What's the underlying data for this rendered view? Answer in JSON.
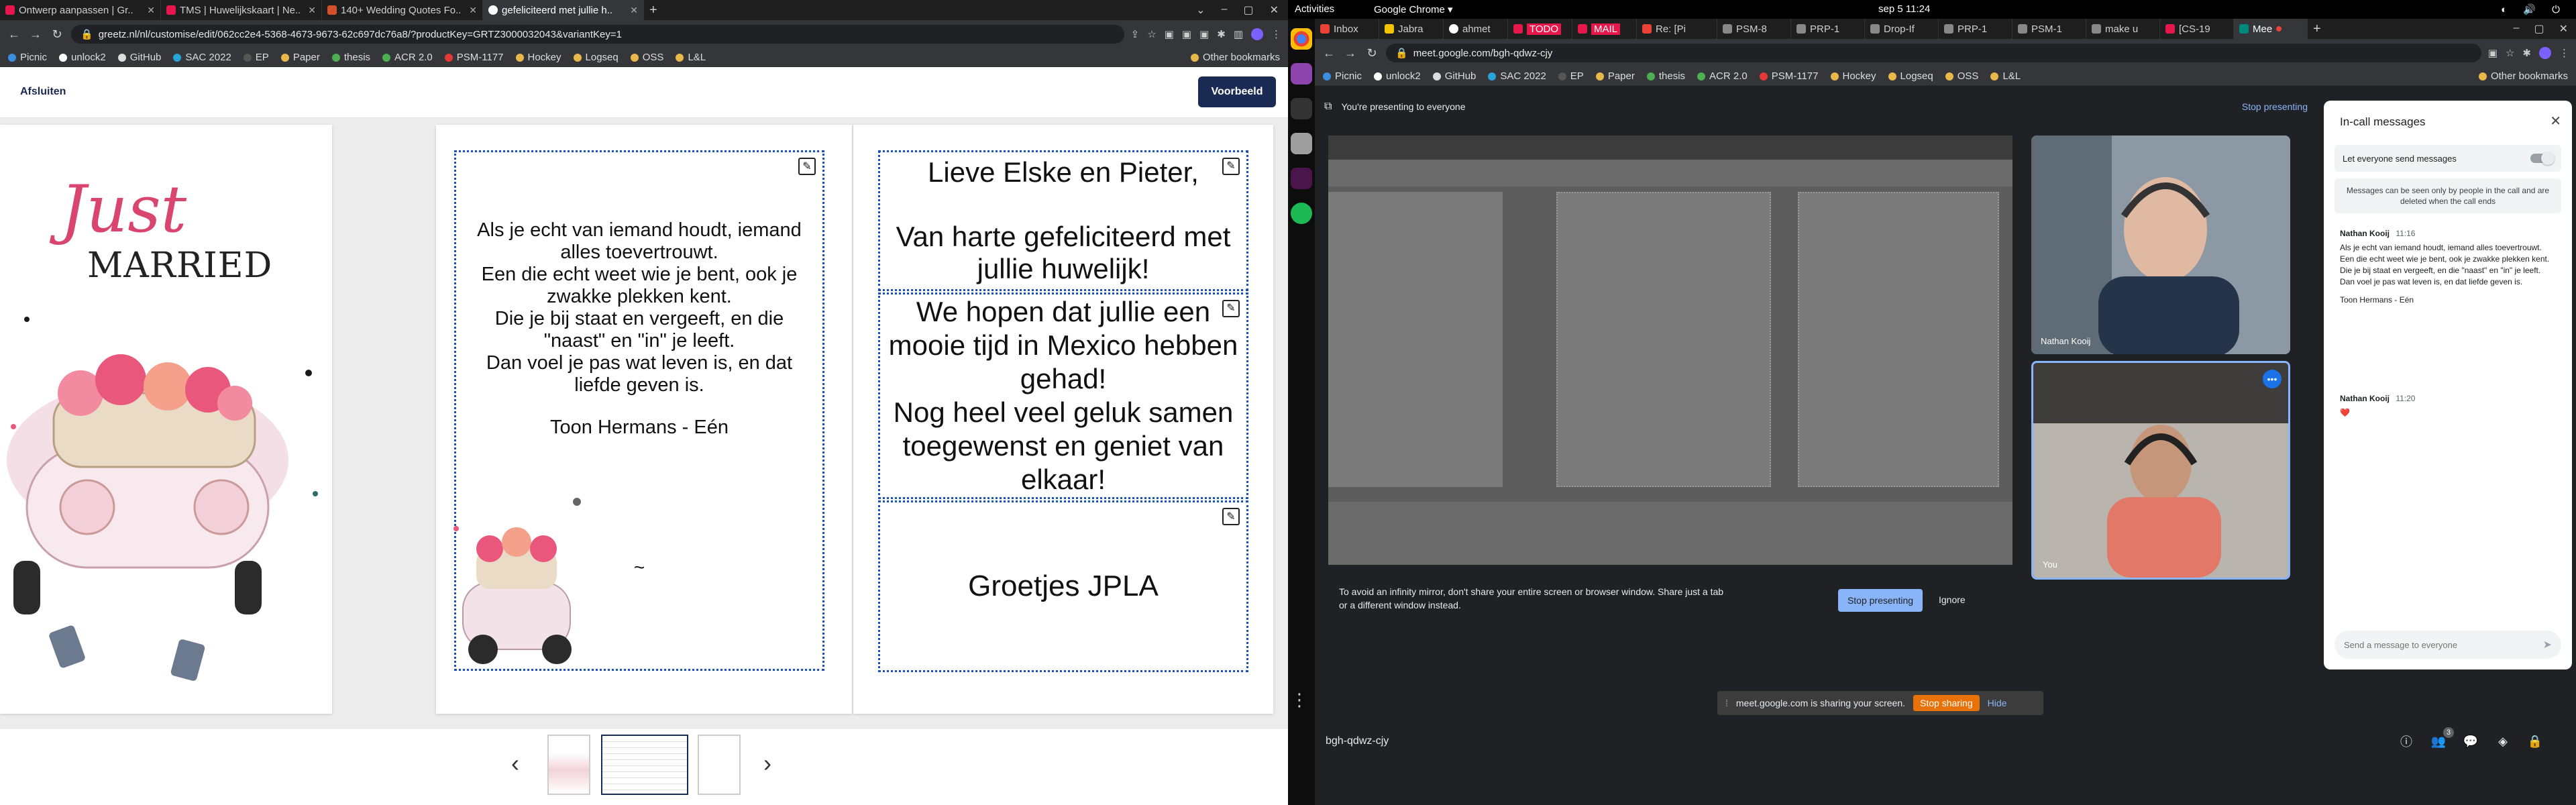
{
  "left_browser": {
    "tabs": [
      {
        "title": "Ontwerp aanpassen | Gr..",
        "color": "#e8174b"
      },
      {
        "title": "TMS | Huwelijkskaart | Ne..",
        "color": "#e8174b"
      },
      {
        "title": "140+ Wedding Quotes Fo..",
        "color": "#d4502a"
      },
      {
        "title": "gefeliciteerd met jullie h..",
        "color": "#8a8a8a",
        "active": true
      }
    ],
    "url": "greetz.nl/nl/customise/edit/062cc2e4-5368-4673-9673-62c697dc76a8/?productKey=GRTZ3000032043&variantKey=1",
    "bookmarks": [
      "Picnic",
      "unlock2",
      "GitHub",
      "SAC 2022",
      "EP",
      "Paper",
      "thesis",
      "ACR 2.0",
      "PSM-1177",
      "Hockey",
      "Logseq",
      "OSS",
      "L&L"
    ],
    "other_bookmarks": "Other bookmarks"
  },
  "editor": {
    "close_label": "Afsluiten",
    "preview_label": "Voorbeeld",
    "front": {
      "title_script": "Just",
      "title_caps": "MARRIED"
    },
    "inside_left": {
      "poem": "Als je echt van iemand houdt, iemand alles toevertrouwt.\nEen die echt weet wie je bent, ook je zwakke plekken kent.\nDie je bij staat en vergeeft, en die \"naast\" en \"in\" je leeft.\nDan voel je pas wat leven is, en dat liefde geven is.",
      "author": "Toon Hermans - Eén",
      "tilde": "~"
    },
    "inside_right": {
      "box1": "Lieve Elske en Pieter,\n\nVan harte gefeliciteerd met jullie huwelijk!",
      "box2": "We hopen dat jullie een mooie tijd in Mexico hebben gehad!\nNog heel veel geluk samen toegewenst en geniet van elkaar!",
      "box3": "Groetjes JPLA"
    },
    "prev_label": "‹",
    "next_label": "›",
    "thumbnails": 4,
    "active_thumbnail": 1
  },
  "system": {
    "activities": "Activities",
    "app_name": "Google Chrome ▾",
    "datetime": "sep 5  11:24"
  },
  "right_browser": {
    "tabs": [
      "Inbox",
      "Jabra",
      "ahmet",
      "TODO",
      "MAIL",
      "Re: [Pi",
      "PSM-8",
      "PRP-1",
      "Drop-If",
      "PRP-1",
      "PSM-1",
      "make u",
      "[CS-19",
      "Mee"
    ],
    "url": "meet.google.com/bgh-qdwz-cjy",
    "bookmarks": [
      "Picnic",
      "unlock2",
      "GitHub",
      "SAC 2022",
      "EP",
      "Paper",
      "thesis",
      "ACR 2.0",
      "PSM-1177",
      "Hockey",
      "Logseq",
      "OSS",
      "L&L"
    ],
    "other_bookmarks": "Other bookmarks"
  },
  "meet": {
    "presenting_banner": "You're presenting to everyone",
    "stop_presenting_link": "Stop presenting",
    "mirror_warning": "To avoid an infinity mirror, don't share your entire screen or browser window. Share just a tab or a different window instead.",
    "stop_presenting_button": "Stop presenting",
    "ignore_button": "Ignore",
    "meeting_code": "bgh-qdwz-cjy",
    "participants": [
      {
        "name": "Nathan Kooij"
      },
      {
        "name": "You"
      }
    ],
    "participant_count": "3",
    "sharing_notice": "meet.google.com is sharing your screen.",
    "stop_sharing": "Stop sharing",
    "hide": "Hide"
  },
  "chat": {
    "title": "In-call messages",
    "let_send": "Let everyone send messages",
    "info": "Messages can be seen only by people in the call and are deleted when the call ends",
    "messages": [
      {
        "sender": "Nathan Kooij",
        "time": "11:16",
        "lines": [
          "Als je echt van iemand houdt, iemand alles toevertrouwt.",
          "Een die echt weet wie je bent, ook je zwakke plekken kent.",
          "Die je bij staat en vergeeft, en die \"naast\" en \"in\" je leeft.",
          "Dan voel je pas wat leven is, en dat liefde geven is.",
          "",
          "Toon Hermans - Eén"
        ]
      },
      {
        "sender": "Nathan Kooij",
        "time": "11:20",
        "lines": [
          "❤️"
        ]
      }
    ],
    "placeholder": "Send a message to everyone"
  }
}
